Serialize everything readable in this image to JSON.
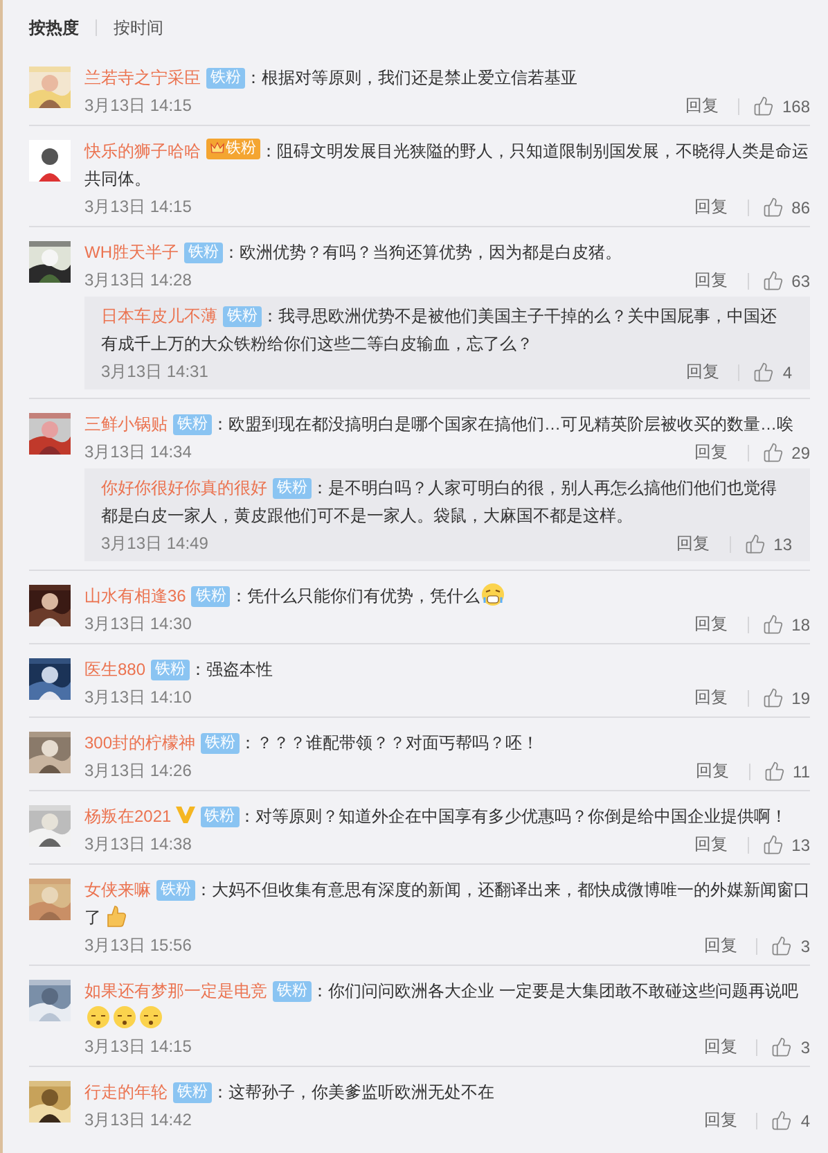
{
  "sort_tabs": [
    {
      "label": "按热度",
      "selected": true
    },
    {
      "label": "按时间",
      "selected": false
    }
  ],
  "comments": [
    {
      "user": "兰若寺之宁采臣",
      "badge": {
        "kind": "fan",
        "label": "铁粉"
      },
      "text": "：根据对等原则，我们还是禁止爱立信若基亚",
      "date": "3月13日 14:15",
      "reply_label": "回复",
      "likes": "168"
    },
    {
      "user": "快乐的狮子哈哈",
      "badge": {
        "kind": "crown",
        "label": "铁粉"
      },
      "text": "：阻碍文明发展目光狭隘的野人，只知道限制别国发展，不晓得人类是命运共同体。",
      "date": "3月13日 14:15",
      "reply_label": "回复",
      "likes": "86"
    },
    {
      "user": "WH胜天半子",
      "badge": {
        "kind": "fan",
        "label": "铁粉"
      },
      "text": "：欧洲优势？有吗？当狗还算优势，因为都是白皮猪。",
      "date": "3月13日 14:28",
      "reply_label": "回复",
      "likes": "63",
      "replies": [
        {
          "user": "日本车皮儿不薄",
          "badge": {
            "kind": "fan",
            "label": "铁粉"
          },
          "text": "：我寻思欧洲优势不是被他们美国主子干掉的么？关中国屁事，中国还有成千上万的大众铁粉给你们这些二等白皮输血，忘了么？",
          "date": "3月13日 14:31",
          "reply_label": "回复",
          "likes": "4"
        }
      ]
    },
    {
      "user": "三鲜小锅贴",
      "badge": {
        "kind": "fan",
        "label": "铁粉"
      },
      "text": "：欧盟到现在都没搞明白是哪个国家在搞他们…可见精英阶层被收买的数量…唉",
      "date": "3月13日 14:34",
      "reply_label": "回复",
      "likes": "29",
      "replies": [
        {
          "user": "你好你很好你真的很好",
          "badge": {
            "kind": "fan",
            "label": "铁粉"
          },
          "text": "：是不明白吗？人家可明白的很，别人再怎么搞他们他们也觉得都是白皮一家人，黄皮跟他们可不是一家人。袋鼠，大麻国不都是这样。",
          "date": "3月13日 14:49",
          "reply_label": "回复",
          "likes": "13"
        }
      ]
    },
    {
      "user": "山水有相逢36",
      "badge": {
        "kind": "fan",
        "label": "铁粉"
      },
      "text": "：凭什么只能你们有优势，凭什么",
      "emojis": [
        {
          "kind": "sweat"
        }
      ],
      "date": "3月13日 14:30",
      "reply_label": "回复",
      "likes": "18"
    },
    {
      "user": "医生880",
      "badge": {
        "kind": "fan",
        "label": "铁粉"
      },
      "text": "：强盗本性",
      "date": "3月13日 14:10",
      "reply_label": "回复",
      "likes": "19"
    },
    {
      "user": "300封的柠檬神",
      "badge": {
        "kind": "fan",
        "label": "铁粉"
      },
      "text": "：？？？谁配带领？？对面丐帮吗？呸！",
      "date": "3月13日 14:26",
      "reply_label": "回复",
      "likes": "11"
    },
    {
      "user": "杨叛在2021",
      "badge": {
        "kind": "fan",
        "label": "铁粉"
      },
      "verified_mark": true,
      "text": "：对等原则？知道外企在中国享有多少优惠吗？你倒是给中国企业提供啊！",
      "date": "3月13日 14:38",
      "reply_label": "回复",
      "likes": "13"
    },
    {
      "user": "女侠来嘛",
      "badge": {
        "kind": "fan",
        "label": "铁粉"
      },
      "text": "：大妈不但收集有意思有深度的新闻，还翻译出来，都快成微博唯一的外媒新闻窗口了",
      "emojis": [
        {
          "kind": "thumb"
        }
      ],
      "date": "3月13日 15:56",
      "reply_label": "回复",
      "likes": "3"
    },
    {
      "user": "如果还有梦那一定是电竞",
      "badge": {
        "kind": "fan",
        "label": "铁粉"
      },
      "text": "：你们问问欧洲各大企业 一定要是大集团敢不敢碰这些问题再说吧",
      "emojis": [
        {
          "kind": "sleepy"
        },
        {
          "kind": "sleepy"
        },
        {
          "kind": "sleepy"
        }
      ],
      "date": "3月13日 14:15",
      "reply_label": "回复",
      "likes": "3"
    },
    {
      "user": "行走的年轮",
      "badge": {
        "kind": "fan",
        "label": "铁粉"
      },
      "text": "：这帮孙子，你美爹监听欧洲无处不在",
      "date": "3月13日 14:42",
      "reply_label": "回复",
      "likes": "4"
    }
  ]
}
